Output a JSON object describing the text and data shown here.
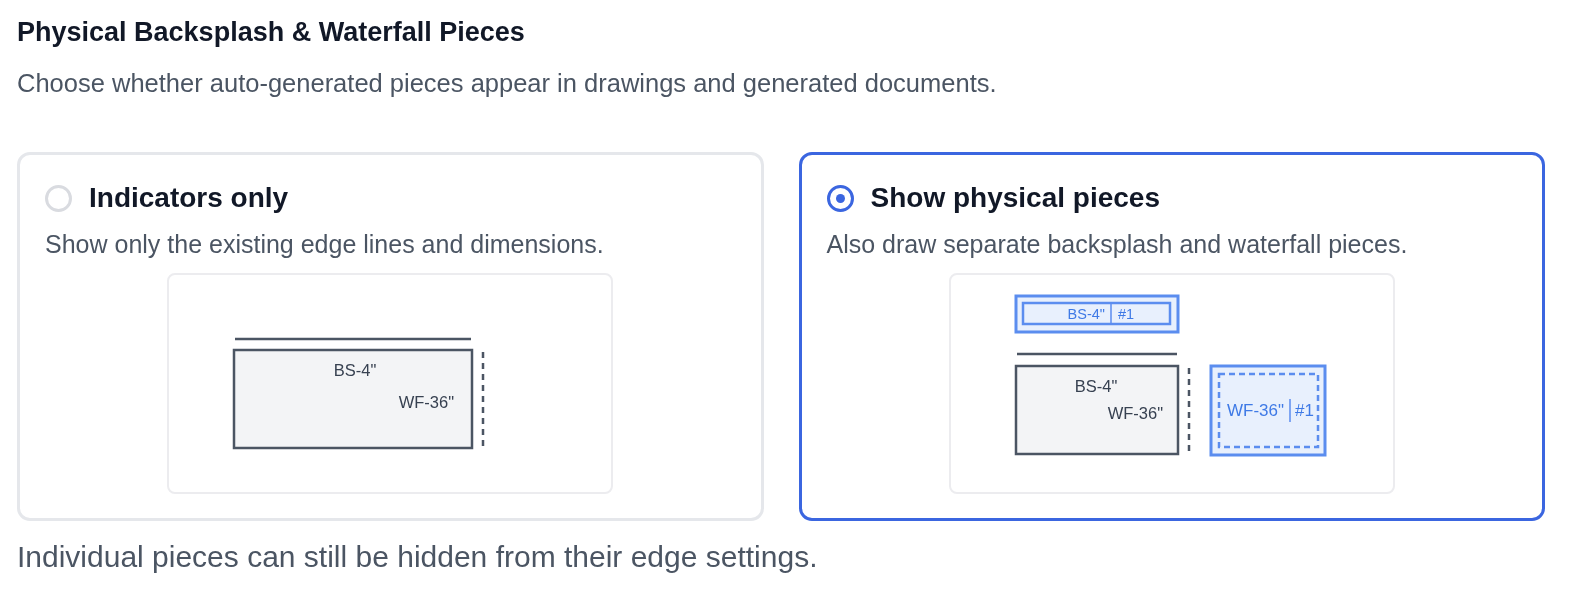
{
  "section": {
    "title": "Physical Backsplash & Waterfall Pieces",
    "description": "Choose whether auto-generated pieces appear in drawings and generated documents."
  },
  "options": [
    {
      "label": "Indicators only",
      "description": "Show only the existing edge lines and dimensions.",
      "selected": false,
      "preview": {
        "kind": "indicators",
        "backsplash_label": "BS-4\"",
        "waterfall_label": "WF-36\""
      }
    },
    {
      "label": "Show physical pieces",
      "description": "Also draw separate backsplash and waterfall pieces.",
      "selected": true,
      "preview": {
        "kind": "pieces",
        "backsplash_label": "BS-4\"",
        "waterfall_label": "WF-36\"",
        "backsplash_piece": {
          "label": "BS-4\"",
          "number": "#1"
        },
        "waterfall_piece": {
          "label": "WF-36\"",
          "number": "#1"
        }
      }
    }
  ],
  "footnote": "Individual pieces can still be hidden from their edge settings."
}
